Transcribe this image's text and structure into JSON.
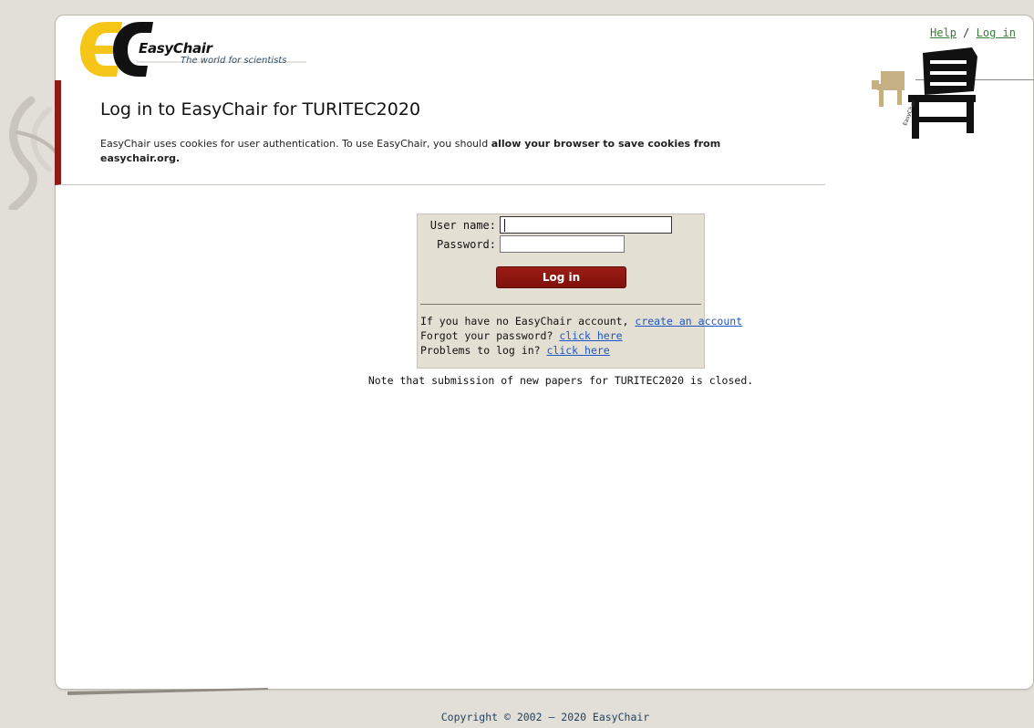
{
  "header": {
    "brand_name": "EasyChair",
    "tagline": "The world for scientists",
    "help_link": "Help",
    "separator": "/",
    "login_link": "Log in"
  },
  "main": {
    "title": "Log in to EasyChair for TURITEC2020",
    "cookie_note_prefix": "EasyChair uses cookies for user authentication. To use EasyChair, you should ",
    "cookie_note_bold": "allow your browser to save cookies from easychair.org."
  },
  "login_form": {
    "username_label": "User name:",
    "username_value": "",
    "password_label": "Password:",
    "password_value": "",
    "submit_label": "Log in",
    "no_account_text": "If you have no EasyChair account, ",
    "create_account_link": "create an account",
    "forgot_text": "Forgot your password? ",
    "forgot_link": "click here",
    "problems_text": "Problems to log in? ",
    "problems_link": "click here"
  },
  "notice": "Note that submission of new papers for TURITEC2020 is closed.",
  "footer": {
    "copyright": "Copyright © 2002 – 2020 EasyChair"
  },
  "colors": {
    "accent": "#8c1a14",
    "link": "#1d55c4",
    "header_link": "#3b7a3b",
    "logo_yellow": "#f5c518",
    "form_bg": "#e4dfd3"
  }
}
